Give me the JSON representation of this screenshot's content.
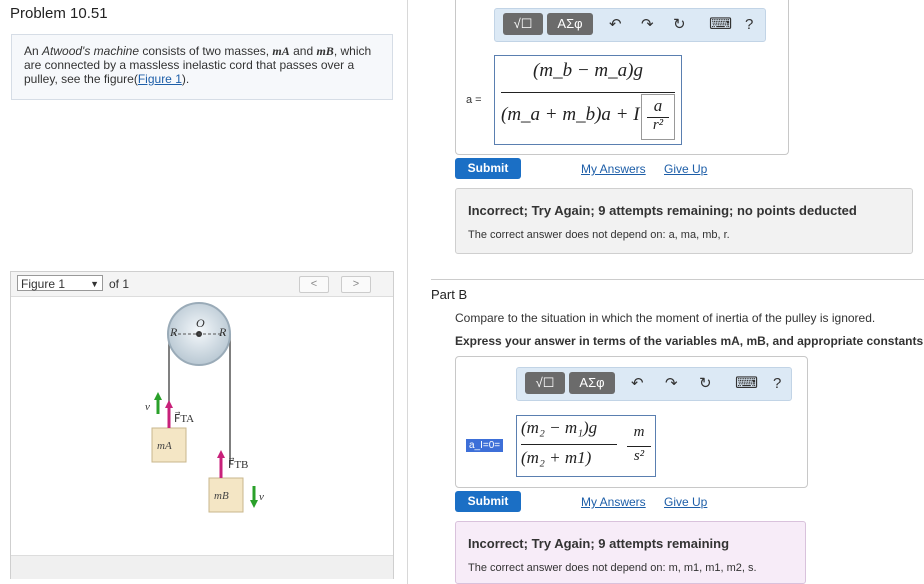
{
  "title": "Problem 10.51",
  "problem": {
    "text_a": "An ",
    "text_italic": "Atwood's machine",
    "text_b": " consists of two masses, ",
    "m_a": "mA",
    "text_and": " and ",
    "m_b": "mB",
    "text_c": ", which are connected by a massless inelastic cord that passes over a pulley, see the figure(",
    "figure_link": "Figure 1",
    "text_d": ")."
  },
  "figure": {
    "selector": "Figure 1",
    "of_label": "of 1",
    "prev": "<",
    "next": ">",
    "labels": {
      "R_left": "R",
      "O": "O",
      "R_right": "R",
      "v_left": "v",
      "FTA": "F⃗TA",
      "mA": "mA",
      "FTB": "F⃗TB",
      "mB": "mB",
      "v_right": "v"
    }
  },
  "toolbar": {
    "templates_label": "√☐",
    "symbols_label": "ΑΣφ",
    "undo": "↶",
    "redo": "↷",
    "reset": "↻",
    "keyboard": "⌨",
    "help": "?"
  },
  "part_a": {
    "answer_label": "a =",
    "numerator": "(m_b − m_a)g",
    "denominator_left": "(m_a + m_b)a + I",
    "denominator_frac_num": "a",
    "denominator_frac_den": "r²",
    "submit": "Submit",
    "my_answers": "My Answers",
    "give_up": "Give Up",
    "feedback_title": "Incorrect; Try Again; 9 attempts remaining; no points deducted",
    "feedback_text": "The correct answer does not depend on: a, ma, mb, r."
  },
  "part_b": {
    "heading": "Part B",
    "prompt1": "Compare to the situation in which the moment of inertia of the pulley is ignored.",
    "prompt2": "Express your answer in terms of the variables mA, mB, and appropriate constants",
    "answer_label": "a_I=0=",
    "numerator": "(m₂ − m₁)g",
    "denominator": "(m₂ + m1)",
    "units_num": "m",
    "units_den": "s²",
    "submit": "Submit",
    "my_answers": "My Answers",
    "give_up": "Give Up",
    "feedback_title": "Incorrect; Try Again; 9 attempts remaining",
    "feedback_text": "The correct answer does not depend on: m, m1, m1, m2, s."
  },
  "colors": {
    "accent": "#1b6fc5",
    "toolbar_bg": "#dce9f5",
    "arrow_green": "#2aa02a",
    "arrow_magenta": "#c8217a"
  }
}
